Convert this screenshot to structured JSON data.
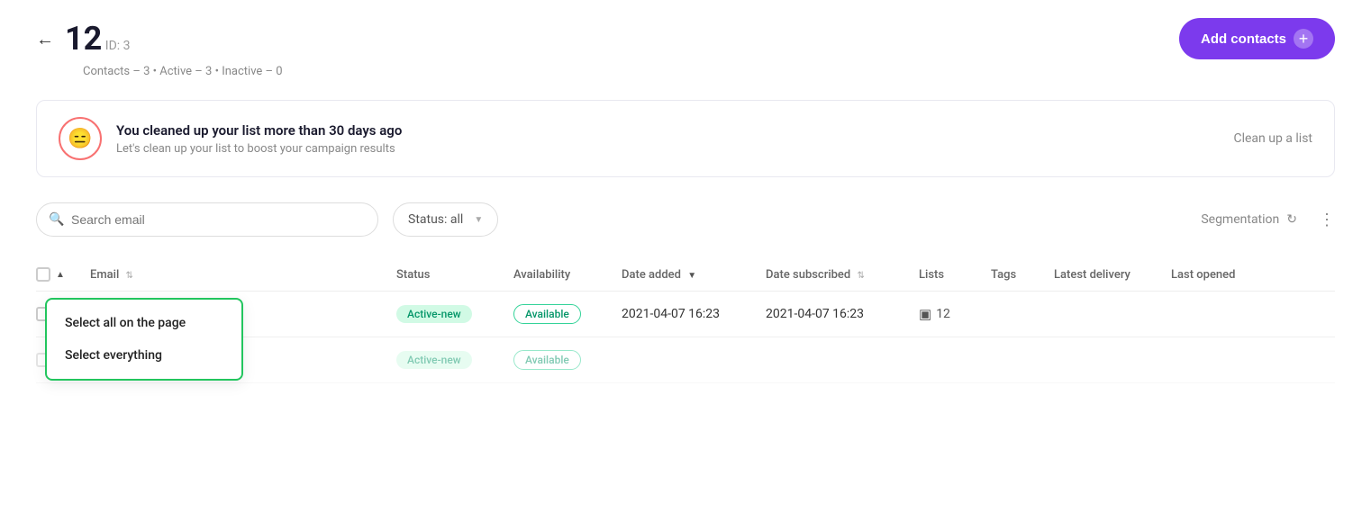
{
  "header": {
    "list_number": "12",
    "list_id": "ID: 3",
    "add_contacts_label": "Add contacts",
    "back_label": "←"
  },
  "stats": {
    "text": "Contacts – 3 • Active – 3 • Inactive – 0"
  },
  "banner": {
    "emoji": "😑",
    "title": "You cleaned up your list more than 30 days ago",
    "subtitle": "Let's clean up your list to boost your campaign results",
    "action": "Clean up a list"
  },
  "filters": {
    "search_placeholder": "Search email",
    "status_label": "Status: all",
    "segmentation_label": "Segmentation"
  },
  "table": {
    "columns": [
      "Email",
      "Status",
      "Availability",
      "Date added",
      "Date subscribed",
      "Lists",
      "Tags",
      "Latest delivery",
      "Last opened"
    ],
    "select_dropdown": {
      "item1": "Select all on the page",
      "item2": "Select everything"
    },
    "rows": [
      {
        "email": "",
        "status": "Active-new",
        "availability": "Available",
        "date_added": "2021-04-07 16:23",
        "date_subscribed": "2021-04-07 16:23",
        "lists": "12",
        "tags": "",
        "latest_delivery": "",
        "last_opened": ""
      },
      {
        "email": "",
        "status": "Active-new",
        "availability": "Available",
        "date_added": "",
        "date_subscribed": "",
        "lists": "",
        "tags": "",
        "latest_delivery": "",
        "last_opened": ""
      }
    ]
  },
  "colors": {
    "accent_purple": "#7c3aed",
    "accent_green": "#22c55e",
    "badge_green_bg": "#d1fae5",
    "badge_green_text": "#059669"
  }
}
